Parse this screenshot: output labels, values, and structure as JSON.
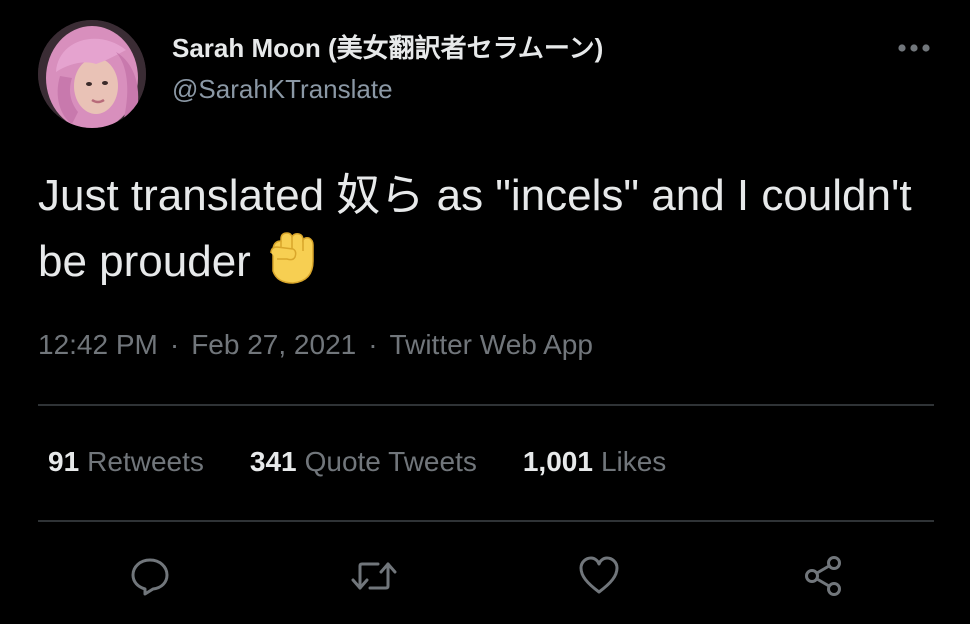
{
  "author": {
    "display_name": "Sarah Moon (美女翻訳者セラムーン)",
    "handle": "@SarahKTranslate",
    "avatar_icon": "avatar-pink-hair"
  },
  "tweet": {
    "text": "Just translated 奴ら as \"incels\" and I couldn't be prouder",
    "emoji": "raised-fist-emoji"
  },
  "meta": {
    "time": "12:42 PM",
    "separator": "·",
    "date": "Feb 27, 2021",
    "source": "Twitter Web App"
  },
  "stats": [
    {
      "count": "91",
      "label": "Retweets"
    },
    {
      "count": "341",
      "label": "Quote Tweets"
    },
    {
      "count": "1,001",
      "label": "Likes"
    }
  ],
  "actions": [
    "reply-icon",
    "retweet-icon",
    "like-icon",
    "share-icon"
  ],
  "colors": {
    "background": "#000000",
    "text_primary": "#e7e9ea",
    "text_secondary": "#71767b",
    "divider": "#2f3336",
    "icon": "#71767b"
  }
}
